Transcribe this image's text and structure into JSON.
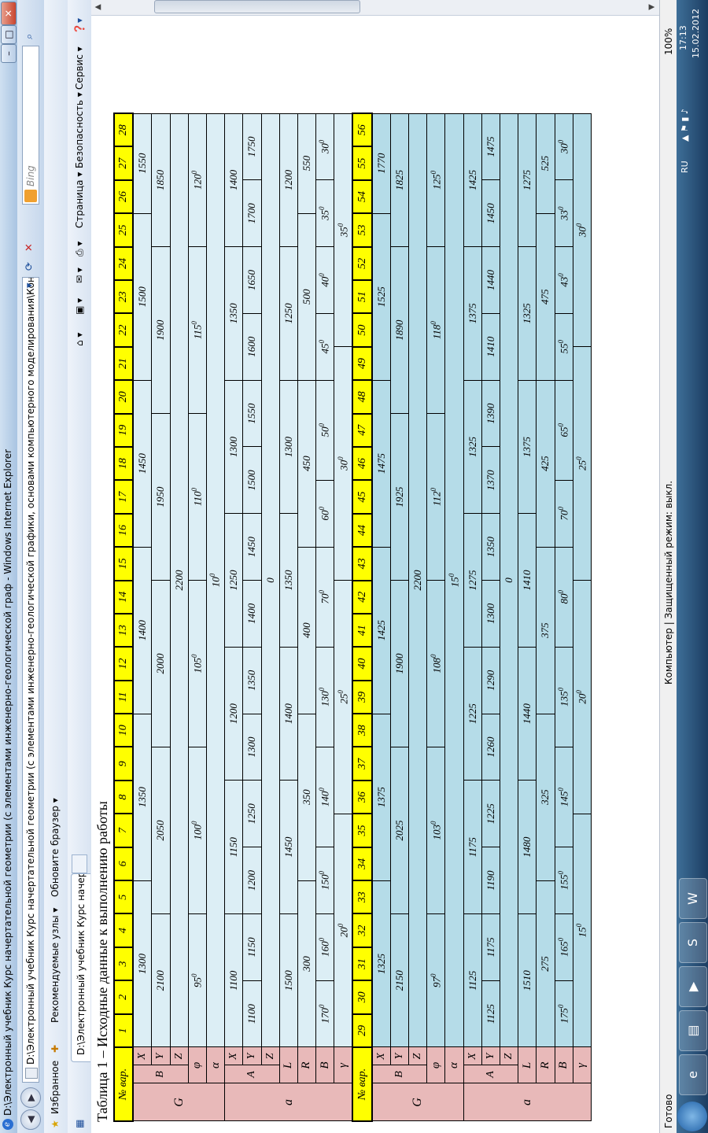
{
  "window": {
    "title": "D:\\Электронный учебник Курс начертательной геометрии (с элементами инженерно-геологической граф - Windows Internet Explorer"
  },
  "address": {
    "url": "D:\\Электронный учебник Курс начертательной геометрии (с элементами инженерно-геологической графики, основами компьютерного моделирования\\Контрольно-изме",
    "search_placeholder": "Bing"
  },
  "favorites": {
    "label": "Избранное",
    "items": [
      "Рекомендуемые узлы ▾",
      "Обновите браузер ▾"
    ]
  },
  "tab": {
    "label": "D:\\Электронный учебник Курс начертательно..."
  },
  "commands": [
    "Страница ▾",
    "Безопасность ▾",
    "Сервис ▾"
  ],
  "statusbar": {
    "ready": "Готово",
    "zone": "Компьютер | Защищенный режим: выкл.",
    "zoom": "100%"
  },
  "tray": {
    "lang": "RU",
    "time": "17:13",
    "date": "15.02.2012"
  },
  "colors": {
    "header": "#ffff00",
    "label": "#e8b9b9",
    "section1": "#dceef5",
    "section2": "#b5dce8"
  },
  "table": {
    "title": "Таблица 1 – Исходные данные к выполнению работы",
    "header_label": "№ вар.",
    "group_G": "G",
    "group_a": "a",
    "labels": {
      "X": "X",
      "Y": "Y",
      "Z": "Z",
      "B": "B",
      "phi": "φ",
      "alpha": "α",
      "A": "A",
      "L": "L",
      "R": "R",
      "beta": "B",
      "gamma": "γ"
    },
    "sec1": {
      "vars": [
        "1",
        "2",
        "3",
        "4",
        "5",
        "6",
        "7",
        "8",
        "9",
        "10",
        "11",
        "12",
        "13",
        "14",
        "15",
        "16",
        "17",
        "18",
        "19",
        "20",
        "21",
        "22",
        "23",
        "24",
        "25",
        "26",
        "27",
        "28"
      ],
      "gX": [
        "1300",
        "1350",
        "1400",
        "1450",
        "1500",
        "1550"
      ],
      "gY": [
        "2100",
        "2050",
        "2000",
        "1950",
        "1900",
        "1850"
      ],
      "gZ": "2200",
      "phi": [
        "95",
        "100",
        "105",
        "110",
        "115",
        "120"
      ],
      "alpha": "10",
      "aX": [
        "1100",
        "1150",
        "1200",
        "1250",
        "1300",
        "1350",
        "1400"
      ],
      "aY": [
        "1100",
        "1150",
        "1200",
        "1250",
        "1300",
        "1350",
        "1400",
        "1450",
        "1500",
        "1550",
        "1600",
        "1650",
        "1700",
        "1750"
      ],
      "aZ": "0",
      "L": [
        "1500",
        "1450",
        "1400",
        "1350",
        "1300",
        "1250",
        "1200"
      ],
      "R": [
        "300",
        "350",
        "400",
        "450",
        "500",
        "550"
      ],
      "beta": [
        "170",
        "160",
        "150",
        "140",
        "130",
        "70",
        "60",
        "50",
        "45",
        "40",
        "35",
        "30"
      ],
      "gamma": [
        "20",
        "25",
        "30",
        "35"
      ]
    },
    "sec2": {
      "vars": [
        "29",
        "30",
        "31",
        "32",
        "33",
        "34",
        "35",
        "36",
        "37",
        "38",
        "39",
        "40",
        "41",
        "42",
        "43",
        "44",
        "45",
        "46",
        "47",
        "48",
        "49",
        "50",
        "51",
        "52",
        "53",
        "54",
        "55",
        "56"
      ],
      "gX": [
        "1325",
        "1375",
        "1425",
        "1475",
        "1525",
        "1770"
      ],
      "gY": [
        "2150",
        "2025",
        "1900",
        "1925",
        "1890",
        "1825"
      ],
      "gZ": "2200",
      "phi": [
        "97",
        "103",
        "108",
        "112",
        "118",
        "125"
      ],
      "alpha": "15",
      "aX": [
        "1125",
        "1175",
        "1225",
        "1275",
        "1325",
        "1375",
        "1425"
      ],
      "aY": [
        "1125",
        "1175",
        "1190",
        "1225",
        "1260",
        "1290",
        "1300",
        "1350",
        "1370",
        "1390",
        "1410",
        "1440",
        "1450",
        "1475"
      ],
      "aZ": "0",
      "L": [
        "1510",
        "1480",
        "1440",
        "1410",
        "1375",
        "1325",
        "1275"
      ],
      "R": [
        "275",
        "325",
        "375",
        "425",
        "475",
        "525"
      ],
      "beta": [
        "175",
        "165",
        "155",
        "145",
        "135",
        "80",
        "70",
        "65",
        "55",
        "43",
        "33",
        "30"
      ],
      "gamma": [
        "15",
        "20",
        "25",
        "30"
      ]
    }
  }
}
